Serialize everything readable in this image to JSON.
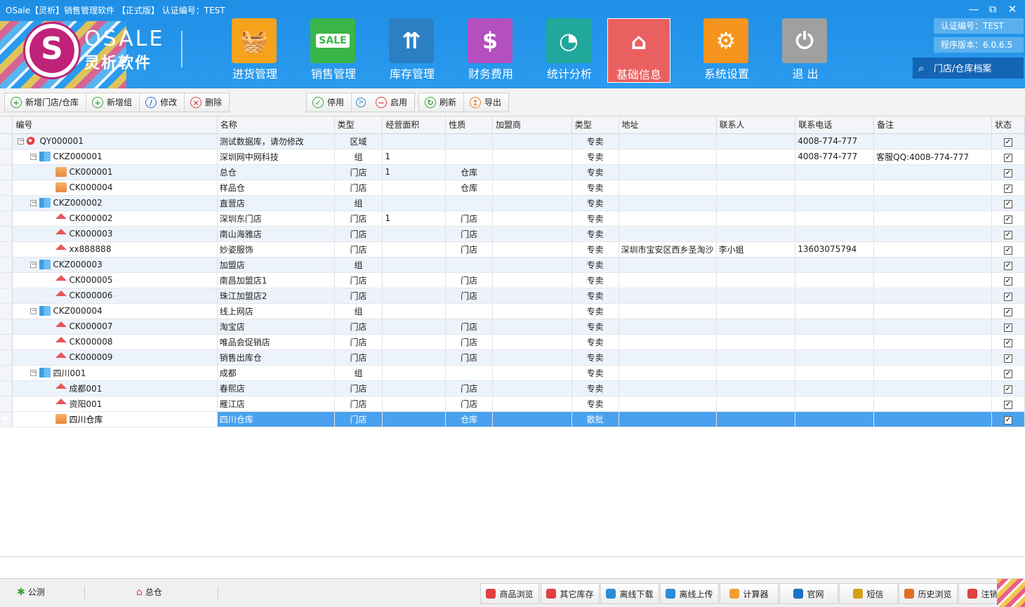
{
  "window": {
    "title": "OSale【灵析】销售管理软件 【正式版】 认证编号：TEST",
    "minimize_glyph": "—",
    "maximize_glyph": "⧉",
    "close_glyph": "✕"
  },
  "logo": {
    "en": "OSALE",
    "cn": "灵析软件"
  },
  "modules": [
    {
      "label": "进货管理",
      "icon": "basket-icon",
      "color": "#f7a21b"
    },
    {
      "label": "销售管理",
      "icon": "sale-sign-icon",
      "color": "#3ab54a",
      "text": "SALE"
    },
    {
      "label": "库存管理",
      "icon": "box-icon",
      "color": "#2b7fc3"
    },
    {
      "label": "财务费用",
      "icon": "money-bag-icon",
      "color": "#b44fbf"
    },
    {
      "label": "统计分析",
      "icon": "pie-chart-icon",
      "color": "#21a89c"
    },
    {
      "label": "基础信息",
      "icon": "home-icon",
      "color": "#ea6060",
      "active": true
    },
    {
      "label": "系统设置",
      "icon": "gear-icon",
      "color": "#f7941e"
    },
    {
      "label": "退 出",
      "icon": "power-icon",
      "color": "#a0a0a0"
    }
  ],
  "info": {
    "cert": "认证编号：TEST",
    "version": "程序版本：6.0.6.5",
    "search_label": "门店/仓库档案"
  },
  "toolbar": {
    "group1": [
      {
        "label": "新增门店/仓库",
        "icon": "add-icon",
        "color": "#3aa33a",
        "glyph": "+"
      },
      {
        "label": "新增组",
        "icon": "add-icon",
        "color": "#3aa33a",
        "glyph": "+"
      },
      {
        "label": "修改",
        "icon": "edit-icon",
        "color": "#2b6fcf",
        "glyph": "/"
      },
      {
        "label": "删除",
        "icon": "delete-icon",
        "color": "#e04040",
        "glyph": "×"
      }
    ],
    "group2": [
      {
        "label": "停用",
        "icon": "check-icon",
        "color": "#3aa33a",
        "glyph": "✓"
      },
      {
        "label": "启用",
        "icon": "minus-icon",
        "color": "#e04040",
        "glyph": "−"
      }
    ],
    "group3": [
      {
        "label": "刷新",
        "icon": "refresh-icon",
        "color": "#3aa33a",
        "glyph": "↻"
      },
      {
        "label": "导出",
        "icon": "export-icon",
        "color": "#f07a1a",
        "glyph": "↥"
      }
    ],
    "separator_glyph": ">"
  },
  "grid": {
    "columns": [
      "编号",
      "名称",
      "类型",
      "经营面积",
      "性质",
      "加盟商",
      "类型",
      "地址",
      "联系人",
      "联系电话",
      "备注",
      "状态"
    ],
    "rows": [
      {
        "level": 0,
        "icon": "pin",
        "exp": "−",
        "code": "QY000001",
        "name": "测试数据库，请勿修改",
        "type": "区域",
        "area": "",
        "nature": "",
        "franchisee": "",
        "type2": "专卖",
        "address": "",
        "contact": "",
        "phone": "4008-774-777",
        "remark": "",
        "checked": "✓"
      },
      {
        "level": 1,
        "icon": "grp",
        "exp": "−",
        "code": "CKZ000001",
        "name": "深圳网中网科技",
        "type": "组",
        "area": "1",
        "nature": "",
        "franchisee": "",
        "type2": "专卖",
        "address": "",
        "contact": "",
        "phone": "4008-774-777",
        "remark": "客服QQ:4008-774-777",
        "checked": "✓"
      },
      {
        "level": 2,
        "icon": "wh",
        "exp": "",
        "code": "CK000001",
        "name": "总仓",
        "type": "门店",
        "area": "1",
        "nature": "仓库",
        "franchisee": "",
        "type2": "专卖",
        "address": "",
        "contact": "",
        "phone": "",
        "remark": "",
        "checked": "✓"
      },
      {
        "level": 2,
        "icon": "wh",
        "exp": "",
        "code": "CK000004",
        "name": "样品仓",
        "type": "门店",
        "area": "",
        "nature": "仓库",
        "franchisee": "",
        "type2": "专卖",
        "address": "",
        "contact": "",
        "phone": "",
        "remark": "",
        "checked": "✓"
      },
      {
        "level": 1,
        "icon": "grp",
        "exp": "−",
        "code": "CKZ000002",
        "name": "直营店",
        "type": "组",
        "area": "",
        "nature": "",
        "franchisee": "",
        "type2": "专卖",
        "address": "",
        "contact": "",
        "phone": "",
        "remark": "",
        "checked": "✓"
      },
      {
        "level": 2,
        "icon": "sh",
        "exp": "",
        "code": "CK000002",
        "name": "深圳东门店",
        "type": "门店",
        "area": "1",
        "nature": "门店",
        "franchisee": "",
        "type2": "专卖",
        "address": "",
        "contact": "",
        "phone": "",
        "remark": "",
        "checked": "✓"
      },
      {
        "level": 2,
        "icon": "sh",
        "exp": "",
        "code": "CK000003",
        "name": "南山海雅店",
        "type": "门店",
        "area": "",
        "nature": "门店",
        "franchisee": "",
        "type2": "专卖",
        "address": "",
        "contact": "",
        "phone": "",
        "remark": "",
        "checked": "✓"
      },
      {
        "level": 2,
        "icon": "sh",
        "exp": "",
        "code": "xx888888",
        "name": "妙姿服饰",
        "type": "门店",
        "area": "",
        "nature": "门店",
        "franchisee": "",
        "type2": "专卖",
        "address": "深圳市宝安区西乡圣淘沙",
        "contact": "李小姐",
        "phone": "13603075794",
        "remark": "",
        "checked": "✓"
      },
      {
        "level": 1,
        "icon": "grp",
        "exp": "−",
        "code": "CKZ000003",
        "name": "加盟店",
        "type": "组",
        "area": "",
        "nature": "",
        "franchisee": "",
        "type2": "专卖",
        "address": "",
        "contact": "",
        "phone": "",
        "remark": "",
        "checked": "✓"
      },
      {
        "level": 2,
        "icon": "sh",
        "exp": "",
        "code": "CK000005",
        "name": "南昌加盟店1",
        "type": "门店",
        "area": "",
        "nature": "门店",
        "franchisee": "",
        "type2": "专卖",
        "address": "",
        "contact": "",
        "phone": "",
        "remark": "",
        "checked": "✓"
      },
      {
        "level": 2,
        "icon": "sh",
        "exp": "",
        "code": "CK000006",
        "name": "珠江加盟店2",
        "type": "门店",
        "area": "",
        "nature": "门店",
        "franchisee": "",
        "type2": "专卖",
        "address": "",
        "contact": "",
        "phone": "",
        "remark": "",
        "checked": "✓"
      },
      {
        "level": 1,
        "icon": "grp",
        "exp": "−",
        "code": "CKZ000004",
        "name": "线上网店",
        "type": "组",
        "area": "",
        "nature": "",
        "franchisee": "",
        "type2": "专卖",
        "address": "",
        "contact": "",
        "phone": "",
        "remark": "",
        "checked": "✓"
      },
      {
        "level": 2,
        "icon": "sh",
        "exp": "",
        "code": "CK000007",
        "name": "淘宝店",
        "type": "门店",
        "area": "",
        "nature": "门店",
        "franchisee": "",
        "type2": "专卖",
        "address": "",
        "contact": "",
        "phone": "",
        "remark": "",
        "checked": "✓"
      },
      {
        "level": 2,
        "icon": "sh",
        "exp": "",
        "code": "CK000008",
        "name": "唯品会促销店",
        "type": "门店",
        "area": "",
        "nature": "门店",
        "franchisee": "",
        "type2": "专卖",
        "address": "",
        "contact": "",
        "phone": "",
        "remark": "",
        "checked": "✓"
      },
      {
        "level": 2,
        "icon": "sh",
        "exp": "",
        "code": "CK000009",
        "name": "销售出库仓",
        "type": "门店",
        "area": "",
        "nature": "门店",
        "franchisee": "",
        "type2": "专卖",
        "address": "",
        "contact": "",
        "phone": "",
        "remark": "",
        "checked": "✓"
      },
      {
        "level": 1,
        "icon": "grp",
        "exp": "−",
        "code": "四川001",
        "name": "成都",
        "type": "组",
        "area": "",
        "nature": "",
        "franchisee": "",
        "type2": "专卖",
        "address": "",
        "contact": "",
        "phone": "",
        "remark": "",
        "checked": "✓"
      },
      {
        "level": 2,
        "icon": "sh",
        "exp": "",
        "code": "成都001",
        "name": "春熙店",
        "type": "门店",
        "area": "",
        "nature": "门店",
        "franchisee": "",
        "type2": "专卖",
        "address": "",
        "contact": "",
        "phone": "",
        "remark": "",
        "checked": "✓"
      },
      {
        "level": 2,
        "icon": "sh",
        "exp": "",
        "code": "资阳001",
        "name": "雁江店",
        "type": "门店",
        "area": "",
        "nature": "门店",
        "franchisee": "",
        "type2": "专卖",
        "address": "",
        "contact": "",
        "phone": "",
        "remark": "",
        "checked": "✓"
      },
      {
        "level": 2,
        "icon": "wh",
        "exp": "",
        "code": "四川仓库",
        "name": "四川仓库",
        "type": "门店",
        "area": "",
        "nature": "仓库",
        "franchisee": "",
        "type2": "散批",
        "address": "",
        "contact": "",
        "phone": "",
        "remark": "",
        "checked": "✓",
        "selected": true,
        "marker": "▶"
      }
    ]
  },
  "statusbar": {
    "left": [
      {
        "label": "公测",
        "icon": "bug-icon",
        "color": "#3aa33a",
        "glyph": "✱"
      },
      {
        "label": "总仓",
        "icon": "home-icon",
        "color": "#e04040",
        "glyph": "⌂"
      }
    ],
    "buttons": [
      {
        "label": "商品浏览",
        "icon": "goods-icon",
        "color": "#e04040"
      },
      {
        "label": "其它库存",
        "icon": "home-icon",
        "color": "#e04040"
      },
      {
        "label": "离线下载",
        "icon": "cloud-download-icon",
        "color": "#2a8bd8"
      },
      {
        "label": "离线上传",
        "icon": "cloud-upload-icon",
        "color": "#2a8bd8"
      },
      {
        "label": "计算器",
        "icon": "calculator-icon",
        "color": "#f0a030"
      },
      {
        "label": "官网",
        "icon": "ie-icon",
        "color": "#1e6fc8"
      },
      {
        "label": "短信",
        "icon": "message-icon",
        "color": "#d4a017"
      },
      {
        "label": "历史浏览",
        "icon": "clock-icon",
        "color": "#e07020"
      },
      {
        "label": "注销",
        "icon": "logout-icon",
        "color": "#e04040"
      }
    ]
  }
}
